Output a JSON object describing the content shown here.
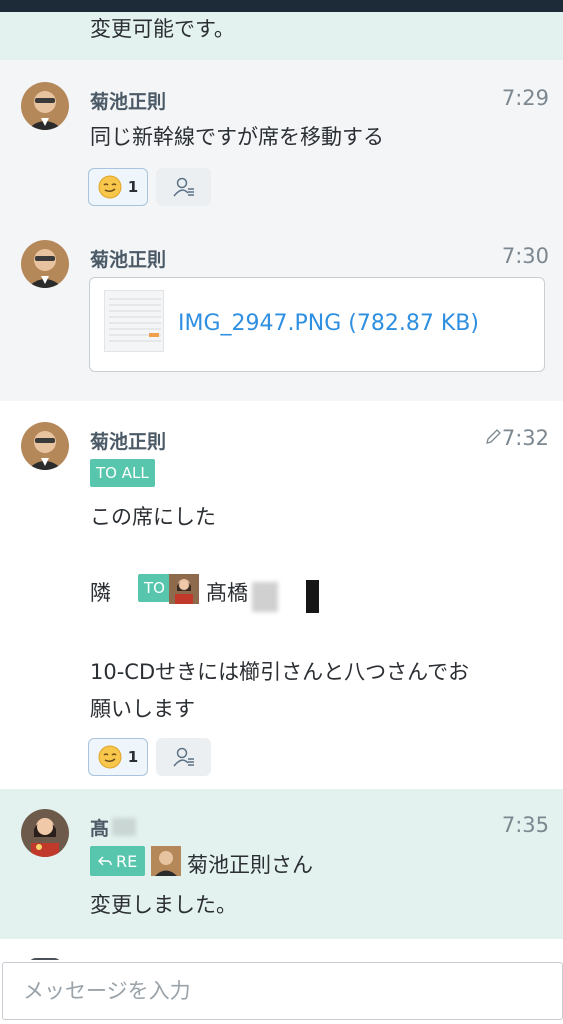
{
  "messages": [
    {
      "text": "変更可能です。"
    },
    {
      "sender": "菊池正則",
      "time": "7:29",
      "text": "同じ新幹線ですが席を移動する",
      "reactions": {
        "count": "1"
      }
    },
    {
      "sender": "菊池正則",
      "time": "7:30",
      "file": {
        "link_text": "IMG_2947.PNG (782.87 KB)"
      }
    },
    {
      "sender": "菊池正則",
      "time": "7:32",
      "edited": true,
      "to_all_tag": "TO ALL",
      "line1": "この席にした",
      "line2_prefix": "隣",
      "to_tag": "TO",
      "to_name": "髙橋",
      "line3": "10-CDせきには櫛引さんと八つさんでお",
      "line4": "願いします",
      "reactions": {
        "count": "1"
      }
    },
    {
      "sender": "髙",
      "time": "7:35",
      "reply_tag": "RE",
      "reply_to": "菊池正則さん",
      "text": "変更しました。"
    }
  ],
  "composer": {
    "placeholder": "メッセージを入力"
  },
  "colors": {
    "accent_tag": "#57c6ad",
    "link": "#2f8fe0",
    "mint_bg": "#e4f2ef",
    "gray_bg": "#f3f5f7"
  }
}
